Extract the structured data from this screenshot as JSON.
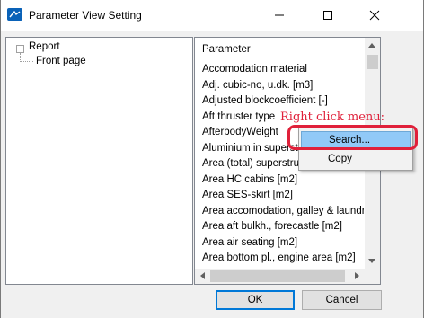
{
  "window": {
    "title": "Parameter View Setting",
    "icons": {
      "app": "app-logo-icon",
      "minimize": "minimize-icon",
      "maximize": "maximize-icon",
      "close": "close-icon"
    }
  },
  "tree": {
    "root_label": "Report",
    "child_label": "Front page"
  },
  "list": {
    "header": "Parameter",
    "items": [
      "Accomodation material",
      "Adj. cubic-no, u.dk. [m3]",
      "Adjusted blockcoefficient [-]",
      "Aft thruster type",
      "AfterbodyWeight",
      "Aluminium in superstru",
      "Area (total) superstru",
      "Area HC cabins [m2]",
      "Area SES-skirt [m2]",
      "Area accomodation, galley & laundry [",
      "Area aft bulkh., forecastle [m2]",
      "Area air seating [m2]",
      "Area bottom pl., engine area [m2]"
    ]
  },
  "buttons": {
    "ok": "OK",
    "cancel": "Cancel"
  },
  "annotation": {
    "text": "Right click menu:",
    "color": "#e0203a"
  },
  "context_menu": {
    "items": [
      "Search...",
      "Copy"
    ],
    "highlight_color": "#91c9f7"
  },
  "colors": {
    "accent": "#0078d7",
    "app_icon": "#0a62b8"
  }
}
